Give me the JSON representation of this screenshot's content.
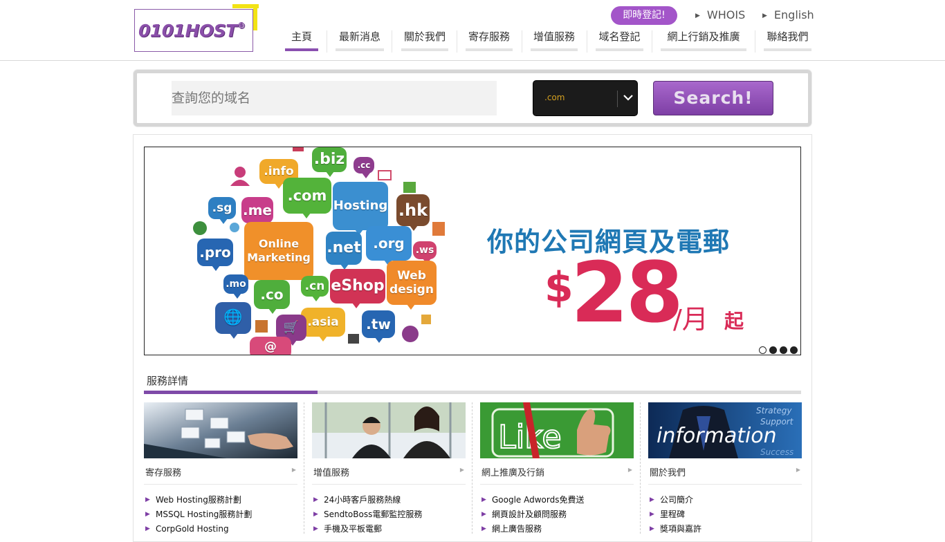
{
  "logo": {
    "text": "0101HOST",
    "trademark": "®"
  },
  "header": {
    "register_label": "即時登記!",
    "whois_label": "WHOIS",
    "english_label": "English"
  },
  "nav": [
    {
      "label": "主頁",
      "active": true
    },
    {
      "label": "最新消息"
    },
    {
      "label": "關於我們"
    },
    {
      "label": "寄存服務"
    },
    {
      "label": "增值服務"
    },
    {
      "label": "域名登記"
    },
    {
      "label": "網上行銷及推廣"
    },
    {
      "label": "聯絡我們"
    }
  ],
  "search": {
    "placeholder": "查詢您的域名",
    "tld_selected": ".com",
    "button_label": "Search!"
  },
  "banner": {
    "bubbles": [
      ".info",
      ".biz",
      ".cc",
      ".sg",
      ".me",
      ".com",
      "Hosting",
      ".hk",
      ".pro",
      "Online Marketing",
      ".net",
      ".org",
      ".ws",
      ".mo",
      ".co",
      ".cn",
      "eShop",
      "Web design",
      ".asia",
      ".tw"
    ],
    "headline": "你的公司網頁及電郵",
    "currency": "$",
    "price": "28",
    "unit": "/月",
    "suffix": "起",
    "slide_count": 4,
    "active_slide": 0
  },
  "services": {
    "title": "服務詳情",
    "columns": [
      {
        "title": "寄存服務",
        "image": "keyboard-email-image",
        "items": [
          "Web Hosting服務計劃",
          "MSSQL Hosting服務計劃",
          "CorpGold Hosting"
        ]
      },
      {
        "title": "增值服務",
        "image": "customer-service-image",
        "items": [
          "24小時客戶服務熱線",
          "SendtoBoss電郵監控服務",
          "手機及平板電郵"
        ]
      },
      {
        "title": "網上推廣及行銷",
        "image": "like-thumb-image",
        "image_text": "Like",
        "items": [
          "Google Adwords免費送",
          "網頁設計及顧問服務",
          "網上廣告服務"
        ]
      },
      {
        "title": "關於我們",
        "image": "information-image",
        "image_text": "information",
        "image_words": [
          "Strategy",
          "Support",
          "Success"
        ],
        "items": [
          "公司簡介",
          "里程碑",
          "獎項與嘉許"
        ]
      }
    ]
  },
  "colors": {
    "brand_purple": "#8a4fb0",
    "price_red": "#d92b57",
    "headline_blue": "#1f78b4"
  }
}
